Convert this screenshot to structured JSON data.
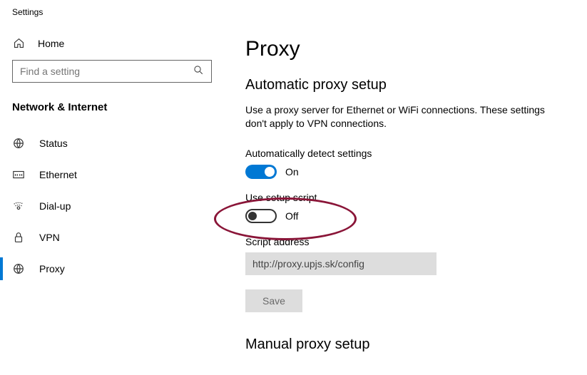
{
  "window": {
    "title": "Settings"
  },
  "sidebar": {
    "home_label": "Home",
    "search_placeholder": "Find a setting",
    "section_title": "Network & Internet",
    "items": [
      {
        "label": "Status"
      },
      {
        "label": "Ethernet"
      },
      {
        "label": "Dial-up"
      },
      {
        "label": "VPN"
      },
      {
        "label": "Proxy"
      }
    ]
  },
  "page": {
    "title": "Proxy",
    "auto_section_title": "Automatic proxy setup",
    "auto_description": "Use a proxy server for Ethernet or WiFi connections. These settings don't apply to VPN connections.",
    "auto_detect_label": "Automatically detect settings",
    "auto_detect_state": "On",
    "setup_script_label": "Use setup script",
    "setup_script_state": "Off",
    "script_address_label": "Script address",
    "script_address_value": "http://proxy.upjs.sk/config",
    "save_label": "Save",
    "manual_section_title": "Manual proxy setup"
  }
}
